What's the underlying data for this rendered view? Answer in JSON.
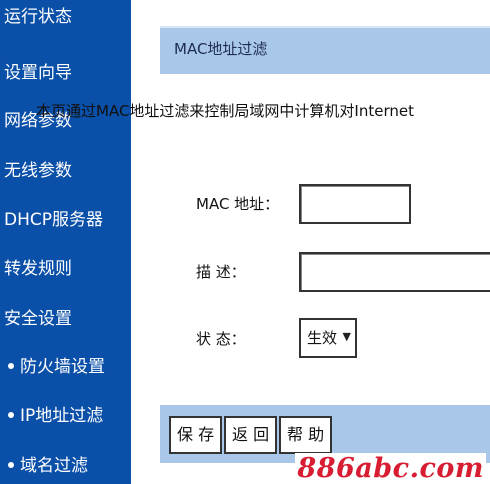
{
  "sidebar": {
    "items": [
      {
        "label": "运行状态",
        "bullet": false
      },
      {
        "label": "设置向导",
        "bullet": false
      },
      {
        "label": "网络参数",
        "bullet": false
      },
      {
        "label": "无线参数",
        "bullet": false
      },
      {
        "label": "DHCP服务器",
        "bullet": false
      },
      {
        "label": "转发规则",
        "bullet": false
      },
      {
        "label": "安全设置",
        "bullet": false
      },
      {
        "label": "防火墙设置",
        "bullet": true
      },
      {
        "label": "IP地址过滤",
        "bullet": true
      },
      {
        "label": "域名过滤",
        "bullet": true
      }
    ]
  },
  "panel": {
    "title": "MAC地址过滤",
    "description": "本页通过MAC地址过滤来控制局域网中计算机对Internet",
    "mac_label": "MAC 地址：",
    "mac_value": "",
    "desc_label": "描  述：",
    "desc_value": "",
    "status_label": "状  态：",
    "status_value": "生效",
    "status_arrow": "▼"
  },
  "buttons": {
    "save": "保 存",
    "back": "返 回",
    "help": "帮 助"
  },
  "watermark": "886abc.com",
  "colors": {
    "sidebar_bg": "#0a4fa8",
    "header_bg": "#a9c7e8",
    "watermark": "#d81c32"
  }
}
